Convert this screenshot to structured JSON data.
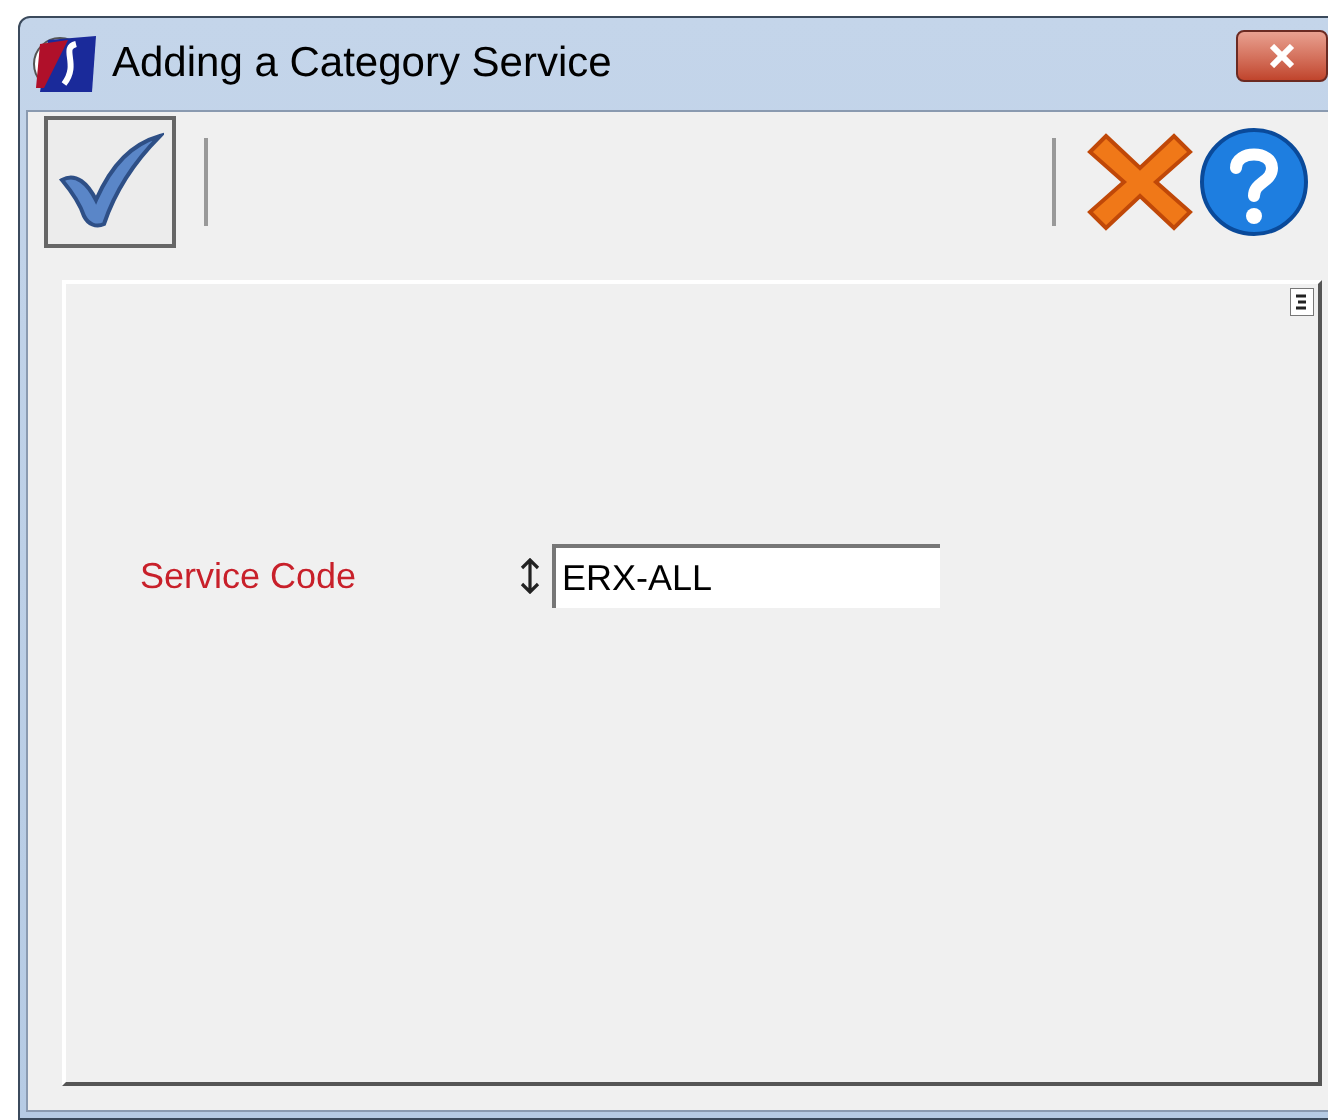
{
  "window": {
    "title": "Adding a Category Service"
  },
  "form": {
    "fields": [
      {
        "label": "Service Code",
        "value": "ERX-ALL"
      }
    ]
  }
}
